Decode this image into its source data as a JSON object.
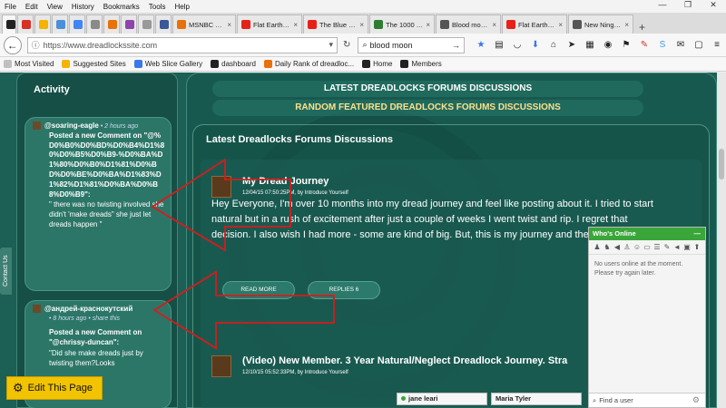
{
  "menubar": {
    "items": [
      "File",
      "Edit",
      "View",
      "History",
      "Bookmarks",
      "Tools",
      "Help"
    ]
  },
  "tabs": [
    {
      "label": "",
      "color": "#222222"
    },
    {
      "label": "",
      "color": "#d93025"
    },
    {
      "label": "",
      "color": "#f4b400"
    },
    {
      "label": "",
      "color": "#4a90d9"
    },
    {
      "label": "",
      "color": "#4285f4"
    },
    {
      "label": "",
      "color": "#8a8a8a"
    },
    {
      "label": "",
      "color": "#e8710a"
    },
    {
      "label": "",
      "color": "#8e44ad"
    },
    {
      "label": "",
      "color": "#999999"
    },
    {
      "label": "",
      "color": "#3b5998"
    },
    {
      "label": "MSNBC and ...",
      "color": "#e8710a"
    },
    {
      "label": "Flat Earth & ...",
      "color": "#e62117"
    },
    {
      "label": "The Blue Mar...",
      "color": "#e62117"
    },
    {
      "label": "The 1000 Yea...",
      "color": "#2e7d32"
    },
    {
      "label": "Blood moon,...",
      "color": "#555555"
    },
    {
      "label": "Flat Earth & ...",
      "color": "#e62117"
    },
    {
      "label": "New Ningja ...",
      "color": "#555555"
    }
  ],
  "navbar": {
    "url": "https://www.dreadlockssite.com",
    "search_value": "blood moon"
  },
  "bookmarks": [
    {
      "label": "Most Visited",
      "color": "#c0c0c0"
    },
    {
      "label": "Suggested Sites",
      "color": "#f4b400"
    },
    {
      "label": "Web Slice Gallery",
      "color": "#3b78e7"
    },
    {
      "label": "dashboard",
      "color": "#222222"
    },
    {
      "label": "Daily Rank of dreadloc...",
      "color": "#e8710a"
    },
    {
      "label": "Home",
      "color": "#222222"
    },
    {
      "label": "Members",
      "color": "#222222"
    }
  ],
  "sidebar": {
    "contact_tab": "Contact Us",
    "edit_button": "Edit This Page",
    "activity_title": "Activity",
    "cards": [
      {
        "user": "@soaring-eagle",
        "time": " • 2 hours ago",
        "head": "Posted a new Comment on \"@%D0%B0%D0%BD%D0%B4%D1%80%D0%B5%D0%B9-%D0%BA%D1%80%D0%B0%D1%81%D0%BD%D0%BE%D0%BA%D1%83%D1%82%D1%81%D0%BA%D0%B8%D0%B9\":",
        "quote": "\" there was no twisting involved she didn't 'make dreads\"  she just let dreads happen \""
      },
      {
        "user": "@андрей-краснокутский",
        "time": " • 8 hours ago • share this",
        "head": "Posted a new Comment on \"@chrissy-duncan\":",
        "quote": "\"Did she make dreads just by twisting them?Looks"
      }
    ]
  },
  "main": {
    "pill1": "LATEST DREADLOCKS FORUMS DISCUSSIONS",
    "pill2": "RANDOM FEATURED DREADLOCKS FORUMS DISCUSSIONS",
    "section_title": "Latest Dreadlocks Forums Discussions",
    "post1": {
      "title": "My Dread Journey",
      "meta": "12/04/15 07:50:25PM, by Introduce Yourself",
      "excerpt": "Hey Everyone, I'm over 10 months into my dread journey and feel like posting about it. I tried to start natural but in a rush of excitement after just a couple of weeks I went twist and rip. I regret that decision. I also wish I had more - some are kind of big. But, this is my journey and the",
      "read_more": "READ MORE",
      "replies": "REPLIES 6"
    },
    "post2": {
      "title": "(Video) New Member. 3 Year Natural/Neglect Dreadlock Journey. Stra",
      "meta": "12/10/15 05:52:33PM, by Introduce Yourself"
    },
    "people": [
      "jane leari",
      "Maria Tyler"
    ]
  },
  "whos_online": {
    "title": "Who's Online",
    "minimize": "—",
    "message": "No users online at the moment. Please try again later.",
    "find_placeholder": "Find a user"
  }
}
